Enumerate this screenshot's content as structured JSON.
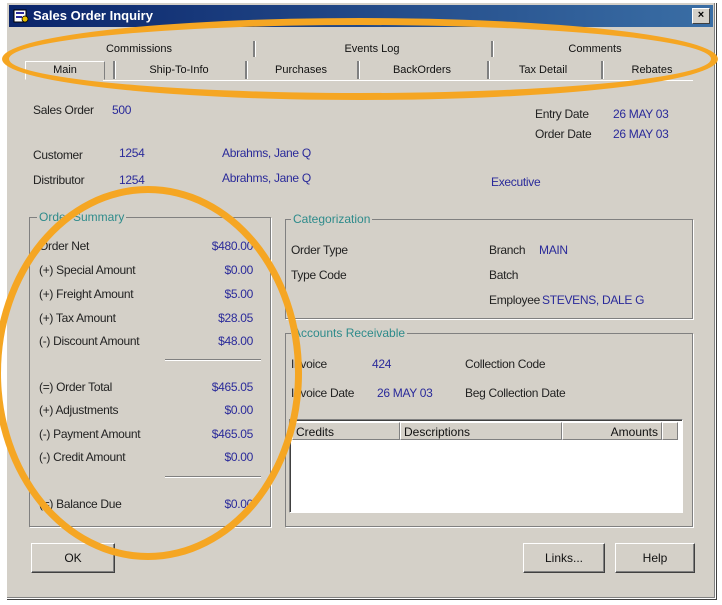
{
  "window": {
    "title": "Sales Order Inquiry",
    "close": "×"
  },
  "tabs_back": [
    "Commissions",
    "Events Log",
    "Comments"
  ],
  "tabs_front": [
    "Main",
    "Ship-To-Info",
    "Purchases",
    "BackOrders",
    "Tax Detail",
    "Rebates"
  ],
  "header": {
    "sales_order_label": "Sales Order",
    "sales_order_value": "500",
    "entry_date_label": "Entry Date",
    "entry_date_value": "26 MAY 03",
    "order_date_label": "Order Date",
    "order_date_value": "26 MAY 03",
    "customer_label": "Customer",
    "customer_id": "1254",
    "customer_name": "Abrahms, Jane Q",
    "distributor_label": "Distributor",
    "distributor_id": "1254",
    "distributor_name": "Abrahms, Jane Q",
    "distributor_type": "Executive"
  },
  "order_summary": {
    "title": "Order Summary",
    "rows1": [
      {
        "label": "Order Net",
        "amount": "$480.00"
      },
      {
        "label": "(+) Special Amount",
        "amount": "$0.00"
      },
      {
        "label": "(+) Freight Amount",
        "amount": "$5.00"
      },
      {
        "label": "(+) Tax Amount",
        "amount": "$28.05"
      },
      {
        "label": "(-) Discount Amount",
        "amount": "$48.00"
      }
    ],
    "rows2": [
      {
        "label": "(=) Order Total",
        "amount": "$465.05"
      },
      {
        "label": "(+) Adjustments",
        "amount": "$0.00"
      },
      {
        "label": "(-) Payment Amount",
        "amount": "$465.05"
      },
      {
        "label": "(-) Credit Amount",
        "amount": "$0.00"
      }
    ],
    "balance_label": "(=) Balance Due",
    "balance_amount": "$0.00"
  },
  "categorization": {
    "title": "Categorization",
    "order_type_label": "Order Type",
    "type_code_label": "Type Code",
    "branch_label": "Branch",
    "branch_value": "MAIN",
    "batch_label": "Batch",
    "employee_label": "Employee",
    "employee_value": "STEVENS, DALE G"
  },
  "accounts_receivable": {
    "title": "Accounts Receivable",
    "invoice_label": "Invoice",
    "invoice_value": "424",
    "collection_code_label": "Collection Code",
    "invoice_date_label": "Invoice Date",
    "invoice_date_value": "26 MAY 03",
    "beg_collection_date_label": "Beg Collection Date",
    "columns": [
      "Credits",
      "Descriptions",
      "Amounts"
    ]
  },
  "buttons": {
    "ok": "OK",
    "links": "Links...",
    "help": "Help"
  },
  "colors": {
    "annotation": "#f5a623",
    "value_text": "#2a2a9a",
    "group_title": "#2e8b8b",
    "titlebar": "#0a246a"
  }
}
